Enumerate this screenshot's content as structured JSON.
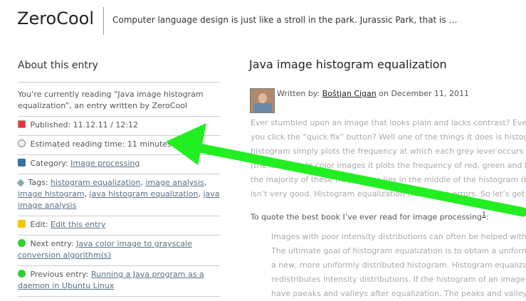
{
  "header": {
    "site_title": "ZeroCool",
    "tagline": "Computer language design is just like a stroll in the park. Jurassic Park, that is …"
  },
  "sidebar": {
    "title": "About this entry",
    "intro": "You’re currently reading “Java image histogram equalization”, an entry written by ZeroCool",
    "published_label": "Published:",
    "published_value": "11.12.11 / 12:12",
    "reading_label": "Estimated reading time:",
    "reading_value": "11 minutes",
    "category_label": "Category:",
    "category_link": "Image processing",
    "tags_label": "Tags:",
    "tags": [
      "histogram equalization",
      "image analysis",
      "image histogram",
      "java histogram equalization",
      "java image analysis"
    ],
    "edit_label": "Edit:",
    "edit_link": "Edit this entry",
    "next_label": "Next entry:",
    "next_link": "Java color image to grayscale conversion algorithm(s)",
    "prev_label": "Previous entry:",
    "prev_link": "Running a Java program as a daemon in Ubuntu Linux"
  },
  "post": {
    "title": "Java image histogram equalization",
    "written_by": "Written by:",
    "author": "Boštjan Cigan",
    "date": "on December 11, 2011",
    "para1_lines": [
      "Ever stumbled upon an image that looks plain and lacks contrast? Ever w",
      "you click the “quick fix” button? Well one of the things it does is histogra",
      "histogram simply plots the frequency at which each grey level occurs fro",
      "(the images). In color images it plots the frequency of red, green and bl",
      "the majority of these frequencies lies in the middle of the histogram (bet",
      "isn’t very good. Histogram equalization fixes these errors. So let’s get to"
    ],
    "para2": "To quote the best book I’ve ever read for image processing",
    "footnote": "1",
    "para2_end": ":",
    "quote_lines": [
      "Images with poor intensity distributions can often be helped with a",
      "The ultimate goal of histogram equalization is to obtain a uniform h",
      "a new, more uniformly distributed histogram. Histogram equalizatio",
      "redistributes intensity distributions. If the histogram of an image h",
      "have paeaks and valleys after equalization. The peaks and valleys w"
    ]
  },
  "annotation": {
    "arrow_color": "#22ee22"
  }
}
